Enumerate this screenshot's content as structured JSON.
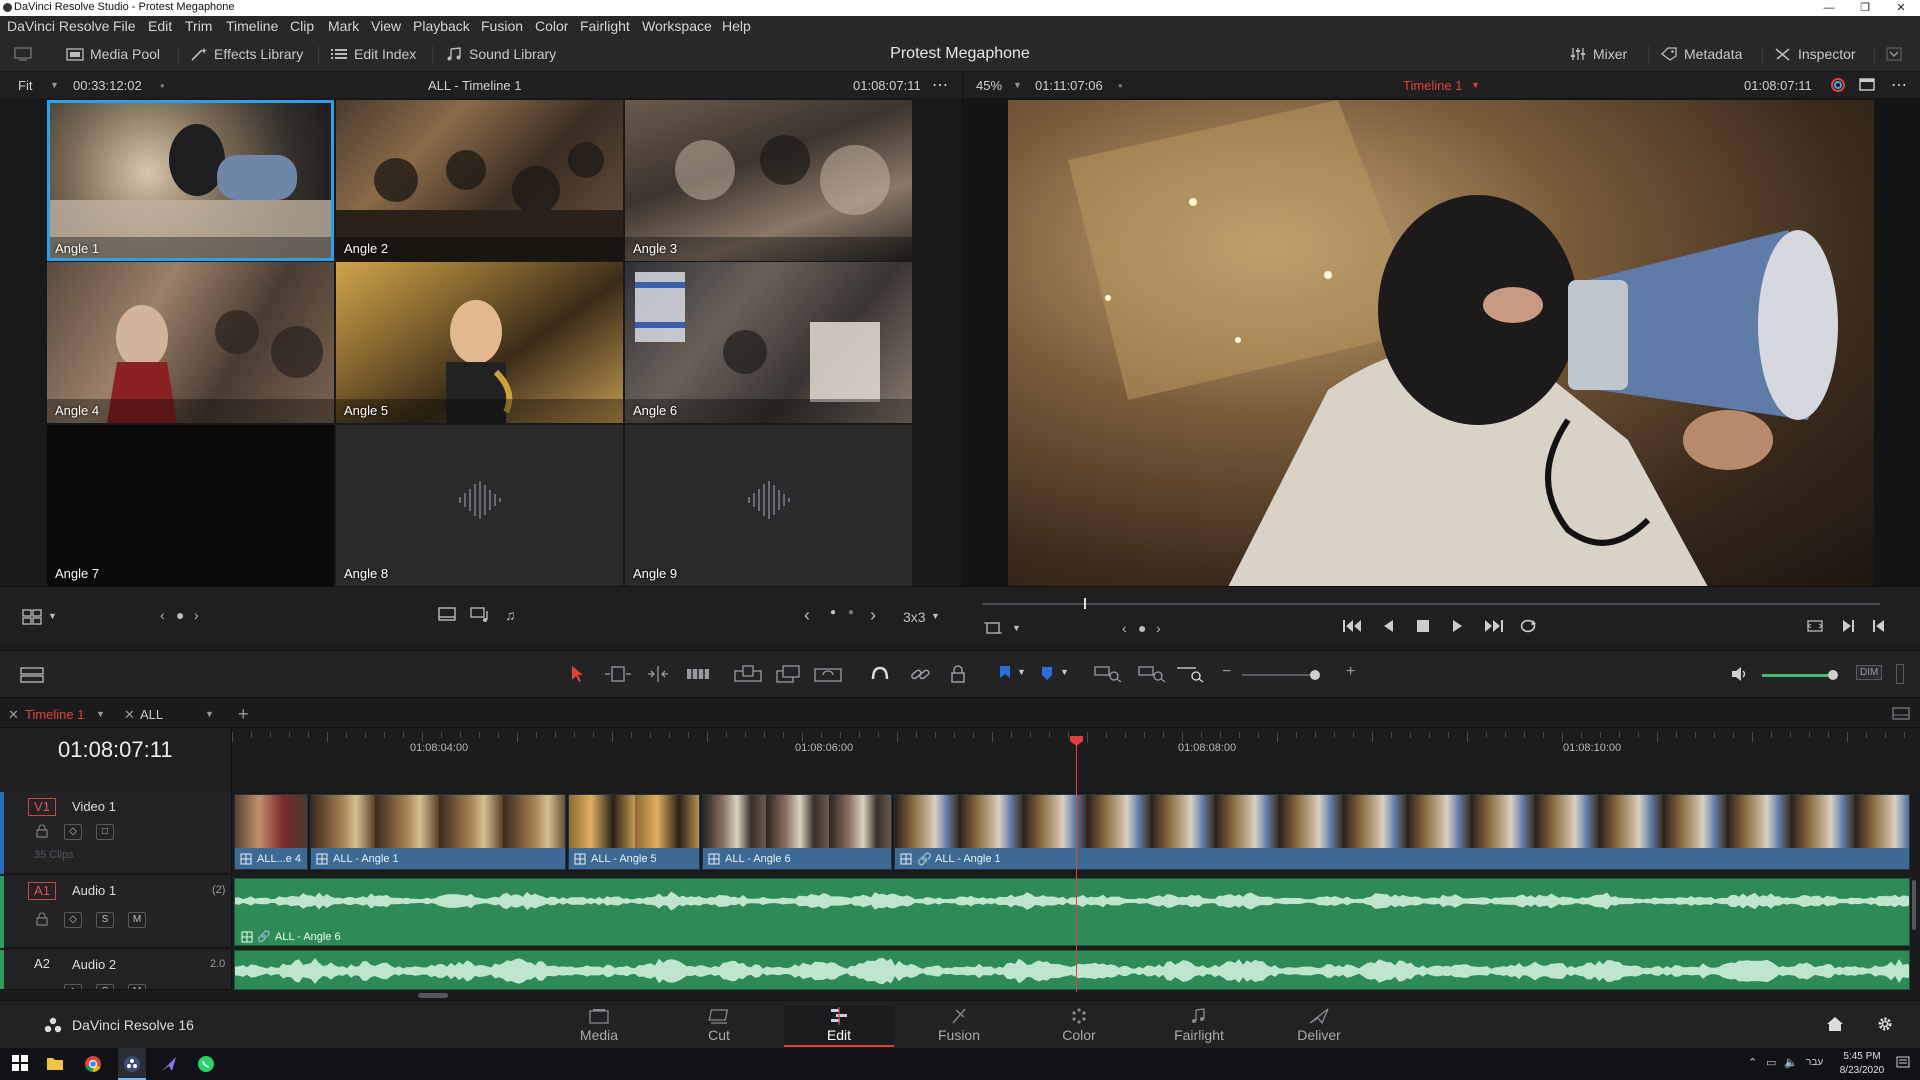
{
  "window": {
    "title": "DaVinci Resolve Studio - Protest Megaphone"
  },
  "menu": [
    "DaVinci Resolve",
    "File",
    "Edit",
    "Trim",
    "Timeline",
    "Clip",
    "Mark",
    "View",
    "Playback",
    "Fusion",
    "Color",
    "Fairlight",
    "Workspace",
    "Help"
  ],
  "toolbar": {
    "media_pool": "Media Pool",
    "effects_library": "Effects Library",
    "edit_index": "Edit Index",
    "sound_library": "Sound Library",
    "project_title": "Protest Megaphone",
    "mixer": "Mixer",
    "metadata": "Metadata",
    "inspector": "Inspector"
  },
  "source_viewer": {
    "zoom": "Fit",
    "timecode_left": "00:33:12:02",
    "title": "ALL - Timeline 1",
    "timecode_right": "01:08:07:11",
    "angles": [
      "Angle 1",
      "Angle 2",
      "Angle 3",
      "Angle 4",
      "Angle 5",
      "Angle 6",
      "Angle 7",
      "Angle 8",
      "Angle 9"
    ],
    "grid": "3x3"
  },
  "program_viewer": {
    "zoom": "45%",
    "timecode_left": "01:11:07:06",
    "timeline_name": "Timeline 1",
    "timecode_right": "01:08:07:11"
  },
  "timeline": {
    "tabs": [
      "Timeline 1",
      "ALL"
    ],
    "current_timecode": "01:08:07:11",
    "ruler": [
      "01:08:04:00",
      "01:08:06:00",
      "01:08:08:00",
      "01:08:10:00"
    ],
    "tracks": {
      "v1": {
        "id": "V1",
        "name": "Video 1",
        "clips_count": "35 Clips"
      },
      "a1": {
        "id": "A1",
        "name": "Audio 1",
        "channels": "(2)"
      },
      "a2": {
        "id": "A2",
        "name": "Audio 2",
        "channels": "2.0"
      }
    },
    "video_clips": [
      "ALL...e 4",
      "ALL - Angle 1",
      "ALL - Angle 5",
      "ALL - Angle 6",
      "ALL - Angle 1"
    ],
    "audio_clip_label": "ALL - Angle 6",
    "dim_label": "DIM"
  },
  "pagebar": {
    "app_name": "DaVinci Resolve 16",
    "pages": [
      "Media",
      "Cut",
      "Edit",
      "Fusion",
      "Color",
      "Fairlight",
      "Deliver"
    ],
    "active_page": "Edit"
  },
  "taskbar": {
    "time": "5:45 PM",
    "date": "8/23/2020",
    "lang": "עבר"
  },
  "colors": {
    "accent_blue": "#2ea0e8",
    "playhead_red": "#e2403a",
    "clip_blue": "#3c6a95",
    "audio_green": "#2e8a57"
  }
}
